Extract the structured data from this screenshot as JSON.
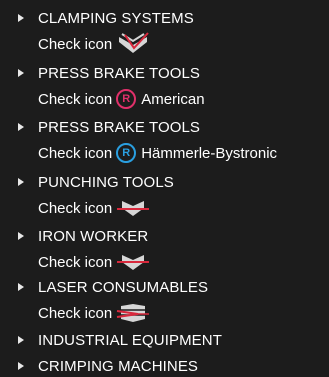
{
  "menu": {
    "items": [
      {
        "label": "CLAMPING SYSTEMS",
        "sub": {
          "text": "Check icon",
          "icon": "clamp-tool-icon"
        }
      },
      {
        "label": "PRESS BRAKE TOOLS",
        "sub": {
          "text": "Check icon",
          "badge": "R",
          "badge_color": "#e0306a",
          "brand": "American"
        }
      },
      {
        "label": "PRESS BRAKE TOOLS",
        "sub": {
          "text": "Check icon",
          "badge": "R",
          "badge_color": "#2a9fe0",
          "brand": "Hämmerle-Bystronic"
        }
      },
      {
        "label": "PUNCHING TOOLS",
        "sub": {
          "text": "Check icon",
          "icon": "punch-tool-icon"
        }
      },
      {
        "label": "IRON WORKER",
        "sub": {
          "text": "Check icon",
          "icon": "iron-worker-icon"
        }
      },
      {
        "label": "LASER CONSUMABLES",
        "sub": {
          "text": "Check icon",
          "icon": "laser-nozzle-icon"
        }
      },
      {
        "label": "INDUSTRIAL EQUIPMENT"
      },
      {
        "label": "CRIMPING MACHINES"
      }
    ]
  },
  "colors": {
    "background": "#1c1c1c",
    "text": "#ffffff",
    "accent_red": "#d8283c",
    "icon_grey": "#d6d6d6"
  }
}
